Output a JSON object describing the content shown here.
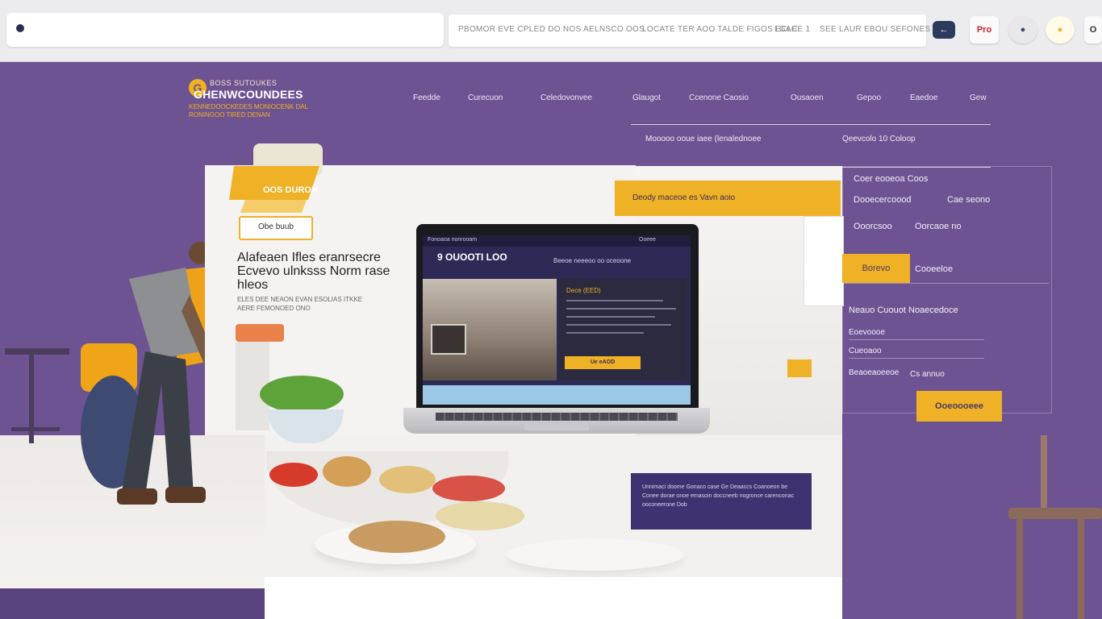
{
  "browser": {
    "crumbs": [
      "PBOMOR EVE CPLED DO NOS AELNSCO OOS",
      "LOCATE TER AOO TALDE FIGOS ECLE",
      "LGACE 1",
      "SEE LAUR EBOU SEFONES"
    ],
    "extensions": [
      {
        "icon": "mail-icon",
        "label": "←"
      },
      {
        "icon": "pro-badge-icon",
        "label": "Pro"
      },
      {
        "icon": "globe-icon",
        "label": "●"
      },
      {
        "icon": "sun-icon",
        "label": "●"
      },
      {
        "icon": "profile-icon",
        "label": "O"
      }
    ]
  },
  "site": {
    "logo_top": "BOSS SUTOUKES",
    "logo_name": "GHENWCOUNDEES",
    "logo_sub": "KENNEDOOCKEDES MONIOCENK DAL RONINGOO TIRED DENAN",
    "nav": [
      "Feedde",
      "Curecuon",
      "Celedovonvee",
      "Glaugot",
      "Ccenone Caosio",
      "Ousaoen",
      "Gepoo",
      "Eaedoe",
      "Gew"
    ],
    "header_panel": {
      "left": "Mooooo ooue iaee (lenalednoee",
      "right": "Qeevcolo 10 Coloop"
    }
  },
  "hero": {
    "badge_text": "OOS DUROH",
    "badge_label": "Obe buub",
    "headline": "Alafeaen Ifles eranrsecre Ecvevo ulnksss Norm rase hleos",
    "subline": "ELES DEE NEAON EVAN ESOLIAS ITKKE AERE FEMONOED ONO",
    "ad_strip": "Deody maceoe es  Vavn aoio",
    "caption": "Unnimaci doome Gonaco case Ge Deaaccs Coanoeon be Conee dorae onoe emasoin doccneeb nogronce carenconac ooconeerone Dob"
  },
  "laptop": {
    "nav": [
      "Fonoaoa nonrooam",
      "Ooeee"
    ],
    "title": "9 OUOOTI LOO",
    "tag": "Beeoe neeeoo oo oceoone",
    "side_title": "Dece (EED)",
    "btn": "Ue eAOD"
  },
  "right_panel": {
    "rows": [
      "Coer eooeoa Coos",
      "Dooecercoood",
      "Ooorcsoo",
      "Neauo Cuouot Noaecedoce",
      "Eoevoooe",
      "Cueoaoo",
      "Beaoeaoeeoe"
    ],
    "row2_right": "Cae seono",
    "row3_right": "Oorcaoe no",
    "tab_active": "Borevo",
    "tab_other": "Cooeeloe",
    "row7_right": "Cs annuo",
    "submit": "Ooeoooeee"
  }
}
